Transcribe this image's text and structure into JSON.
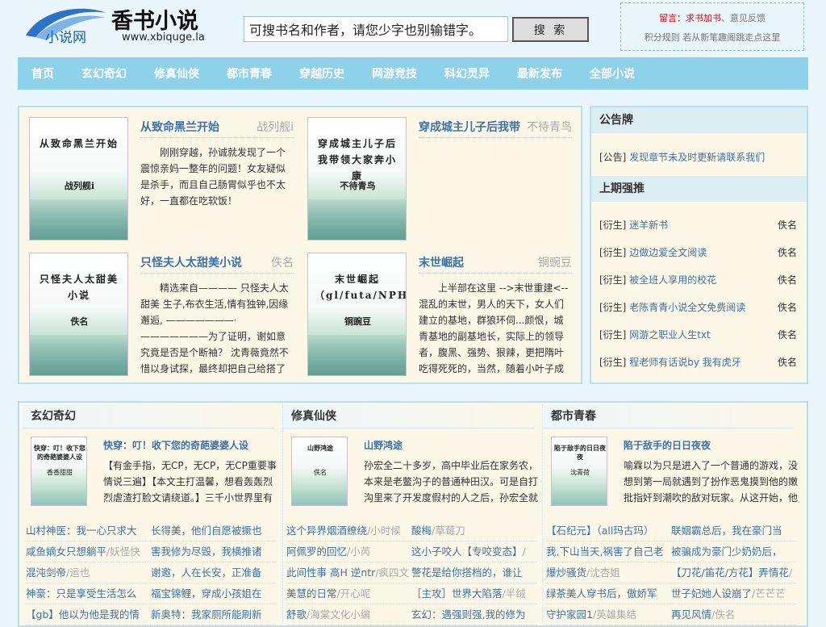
{
  "header": {
    "logo_main": "香书小说",
    "logo_small": "小说网",
    "logo_url": "www.xbiquge.la",
    "search_placeholder": "可搜书名和作者，请您少字也别输错字。",
    "search_button": "搜 索",
    "notice_link1": "留言：求书加书",
    "notice_link2": "意见反馈",
    "notice_line2": "积分规则  若从新笔趣阁跳走点这里"
  },
  "nav": [
    "首页",
    "玄幻奇幻",
    "修真仙侠",
    "都市青春",
    "穿越历史",
    "网游竞技",
    "科幻灵异",
    "最新发布",
    "全部小说"
  ],
  "featured": [
    {
      "title": "从致命黑兰开始",
      "author": "战列舰i",
      "cover_title": "从致命黑兰开始",
      "desc": "刚刚穿越，孙诚就发现了一个震惊亲妈一整年的问题！女友疑似是杀手，而且自己肠胃似乎也不太好，一直都在吃软饭！"
    },
    {
      "title": "穿成城主儿子后我带",
      "author": "不待青鸟",
      "cover_title": "穿成城主儿子后我带领大家奔小康",
      "desc": ""
    },
    {
      "title": "只怪夫人太甜美小说",
      "author": "佚名",
      "cover_title": "只怪夫人太甜美小说",
      "desc": "精选来自———— 只怪夫人太甜美 生子,布衣生活,情有独钟,因缘邂逅, ———————·———————为了证明，谢如意究竟是否是个断袖？ 沈青薇竟然不惜以身试探，最终却把自己给搭了进去！ 谢如意以"
    },
    {
      "title": "末世崛起",
      "author": "铜豌豆",
      "cover_title": "末世崛起（gl/futa/NPH）",
      "desc": "上半部在这里 -->末世重建<--混乱的末世，男人的天下，女人们建立的基地，群狼环伺...颜恨，城青基地的副基地长，实际上的领导者，腹黑、强势、狠辣，更把隋叶吃得死死的，当然，随着小叶子成长为"
    }
  ],
  "side": {
    "h1": "公告牌",
    "notice": {
      "tag": "[公告]",
      "text": "发现章节未及时更新请联系我们"
    },
    "h2": "上期强推",
    "items": [
      {
        "tag": "[衍生]",
        "text": "迷羊新书",
        "author": "佚名"
      },
      {
        "tag": "[衍生]",
        "text": "边做边爱全文阅读",
        "author": "佚名"
      },
      {
        "tag": "[衍生]",
        "text": "被全班人享用的校花",
        "author": "佚名"
      },
      {
        "tag": "[衍生]",
        "text": "老陈青青小说全文免费阅读",
        "author": "佚名"
      },
      {
        "tag": "[衍生]",
        "text": "网游之职业人生txt",
        "author": "佚名"
      },
      {
        "tag": "[衍生]",
        "text": "程老师有话说by 我有虎牙",
        "author": "佚名"
      }
    ]
  },
  "cats": [
    {
      "name": "玄幻奇幻",
      "top_title": "快穿：叮！收下您的奇葩婆婆人设",
      "top_cover": "快穿：叮！收下您的奇葩婆婆人设",
      "top_author": "香香甜甜",
      "desc": "【有金手指，无CP，无CP，无CP重要事情说三遍】【本文主打温馨，想看轰轰烈烈虐渣打脸文请绕道。】三千小世界里有",
      "list": [
        {
          "n": "山村神医：我一心只求大",
          "a": ""
        },
        {
          "n": "长得美，他们自愿被撅也",
          "a": ""
        },
        {
          "n": "咸鱼嫡女只想躺平",
          "a": "/妖怪快"
        },
        {
          "n": "害我修为尽毁，我横推诸",
          "a": ""
        },
        {
          "n": "混沌剑帝",
          "a": "/运也"
        },
        {
          "n": "谢邀，人在长安，正准备",
          "a": ""
        },
        {
          "n": "神豪：只是享受生活怎么",
          "a": ""
        },
        {
          "n": "福宝锦鲤，穿成小孩姐在",
          "a": ""
        },
        {
          "n": "【gb】他以为他是我的情",
          "a": ""
        },
        {
          "n": "新奥特：我家厕所能刷新",
          "a": ""
        }
      ]
    },
    {
      "name": "修真仙侠",
      "top_title": "山野鸿途",
      "top_cover": "山野鸿途",
      "top_author": "佚名",
      "desc": "孙宏全二十多岁，高中毕业后在家务农，本来是老鳖沟子的普通种田汉。可是自打沟里来了开发度假村的人之后，孙宏全就",
      "list": [
        {
          "n": "这个异界烟酒缭绕",
          "a": "/小时候"
        },
        {
          "n": "酸梅",
          "a": "/草莓刀"
        },
        {
          "n": "阿佩罗的回忆",
          "a": "/小芮"
        },
        {
          "n": "这小子咬人【专咬变态】",
          "a": "/"
        },
        {
          "n": "此间性事 高H 逆ntr",
          "a": "/疯四文"
        },
        {
          "n": "警花是给你搭档的，谁让",
          "a": ""
        },
        {
          "n": "美慧的日常",
          "a": "/开心呢"
        },
        {
          "n": "［主攻］世界大陷落",
          "a": "/半绒"
        },
        {
          "n": "舒歌",
          "a": "/海棠文化小编"
        },
        {
          "n": "玄幻：遇强则强,我的修为",
          "a": ""
        }
      ]
    },
    {
      "name": "都市青春",
      "top_title": "陷于敌手的日日夜夜",
      "top_cover": "陷于敌手的日日夜夜",
      "top_author": "沈青荷",
      "desc": "喻霖以为只是进入了一个普通的游戏，没想到第一局就遇到了扮作恶鬼摸到他的嫩批指奸到潮吹的敌对玩家。从这开始，他",
      "list": [
        {
          "n": "【石纪元】（all玛古玛）",
          "a": ""
        },
        {
          "n": "联姻霸总后，我在豪门当",
          "a": ""
        },
        {
          "n": "我,下山当天,祸害了自己老",
          "a": ""
        },
        {
          "n": "被骗成为豪门少奶奶后，",
          "a": ""
        },
        {
          "n": "爆炒骚货",
          "a": "/沈杏姐"
        },
        {
          "n": "【刀花/笛花/方花】弄情花",
          "a": "/"
        },
        {
          "n": "绿茶美人穿书后，傲娇军",
          "a": ""
        },
        {
          "n": "世子妃她人设崩了",
          "a": "/芒芒芒"
        },
        {
          "n": "守护家园1",
          "a": "/英雄集结"
        },
        {
          "n": "再见风情",
          "a": "/佚名"
        }
      ]
    }
  ]
}
